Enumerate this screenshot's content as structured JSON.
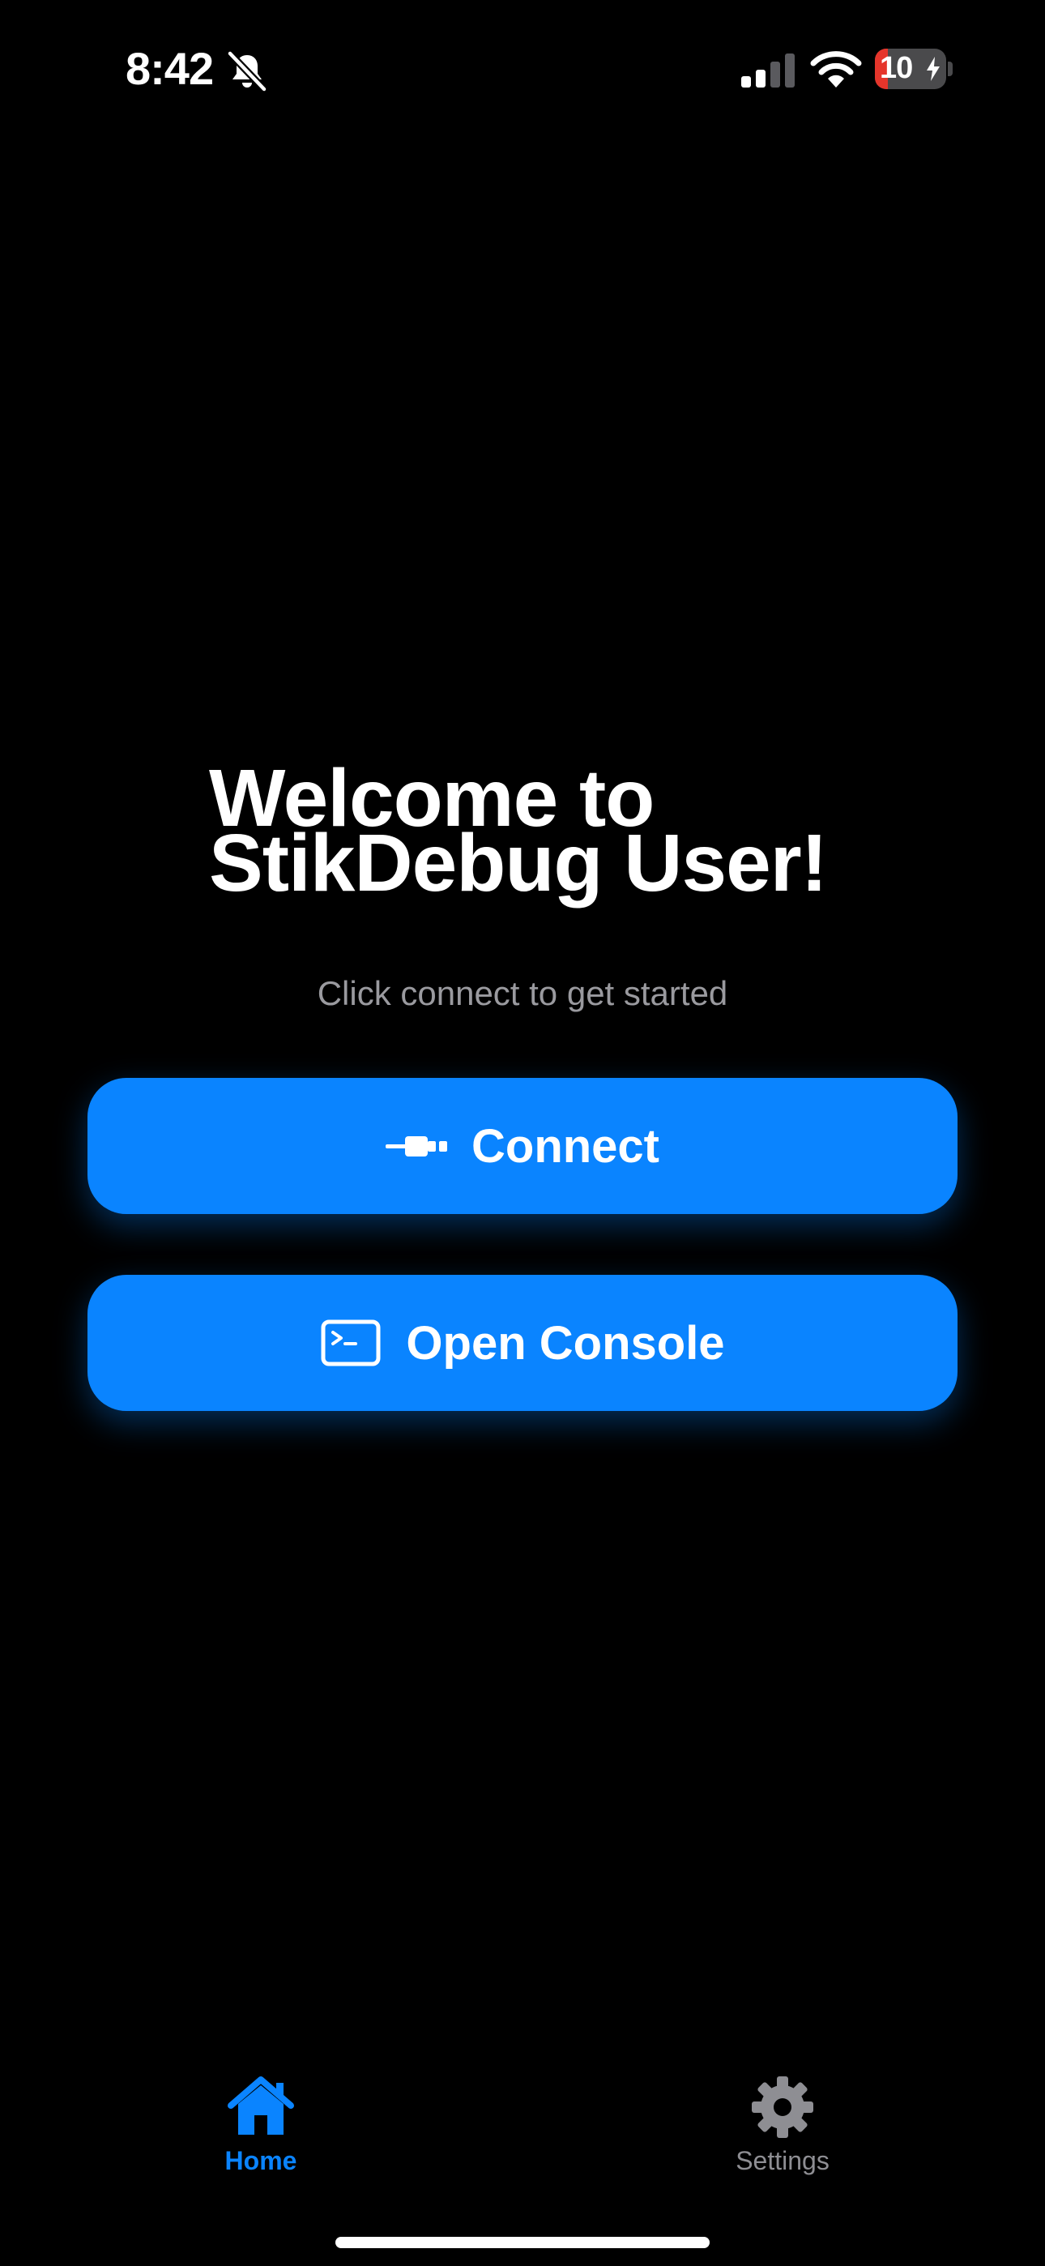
{
  "status_bar": {
    "time": "8:42",
    "battery_level": "10",
    "battery_fraction": 0.1,
    "icons": [
      "bell-slash-icon",
      "cellular-signal-icon",
      "wifi-icon",
      "battery-charging-icon"
    ]
  },
  "main": {
    "title_line1": "Welcome to",
    "title_line2": "StikDebug User!",
    "subtitle": "Click connect to get started",
    "connect_button": {
      "label": "Connect",
      "icon": "cable-connector-icon"
    },
    "console_button": {
      "label": "Open Console",
      "icon": "terminal-icon"
    }
  },
  "tab_bar": {
    "tabs": [
      {
        "label": "Home",
        "icon": "house-icon",
        "selected": true
      },
      {
        "label": "Settings",
        "icon": "gear-icon",
        "selected": false
      }
    ]
  },
  "colors": {
    "background": "#000000",
    "accent": "#0a84ff",
    "subtitle": "#9a9a9f",
    "tab_inactive": "#8e8e93",
    "battery_low": "#e5352b"
  }
}
